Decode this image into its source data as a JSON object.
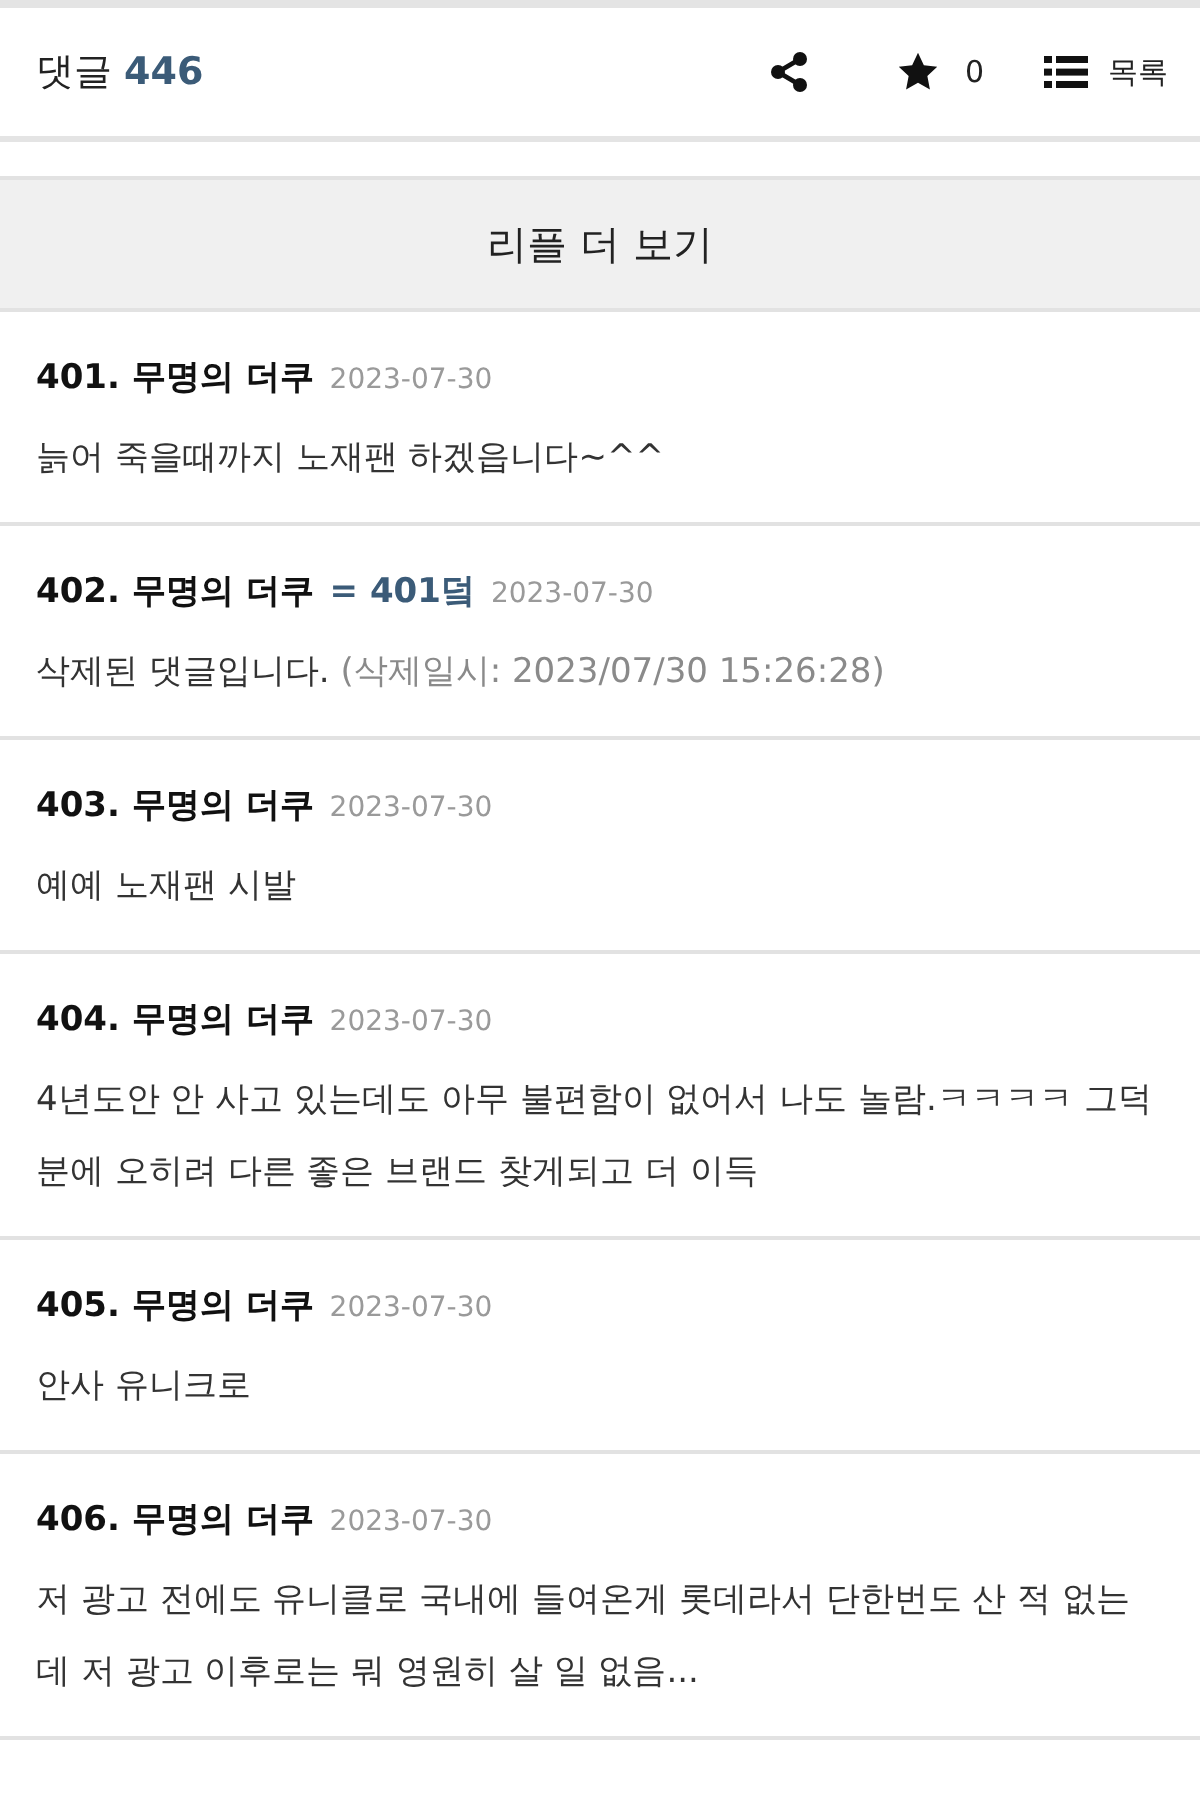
{
  "header": {
    "label": "댓글",
    "count": "446",
    "star_count": "0",
    "list_label": "목록"
  },
  "more_button": "리플 더 보기",
  "comments": [
    {
      "number": "401.",
      "author": "무명의 더쿠",
      "date": "2023-07-30",
      "body": "늙어 죽을때까지 노재팬 하겠읍니다~^^"
    },
    {
      "number": "402.",
      "author": "무명의 더쿠",
      "reply_to": "= 401덬",
      "date": "2023-07-30",
      "body": "삭제된 댓글입니다.",
      "note": "(삭제일시: 2023/07/30 15:26:28)"
    },
    {
      "number": "403.",
      "author": "무명의 더쿠",
      "date": "2023-07-30",
      "body": "예예 노재팬 시발"
    },
    {
      "number": "404.",
      "author": "무명의 더쿠",
      "date": "2023-07-30",
      "body": "4년도안 안 사고 있는데도 아무 불편함이 없어서 나도 놀람.ㅋㅋㅋㅋ 그덕분에 오히려 다른 좋은 브랜드 찾게되고 더 이득"
    },
    {
      "number": "405.",
      "author": "무명의 더쿠",
      "date": "2023-07-30",
      "body": "안사 유니크로"
    },
    {
      "number": "406.",
      "author": "무명의 더쿠",
      "date": "2023-07-30",
      "body": "저 광고 전에도 유니클로 국내에 들여온게 롯데라서 단한번도 산 적 없는데 저 광고 이후로는 뭐 영원히 살 일 없음..."
    }
  ]
}
